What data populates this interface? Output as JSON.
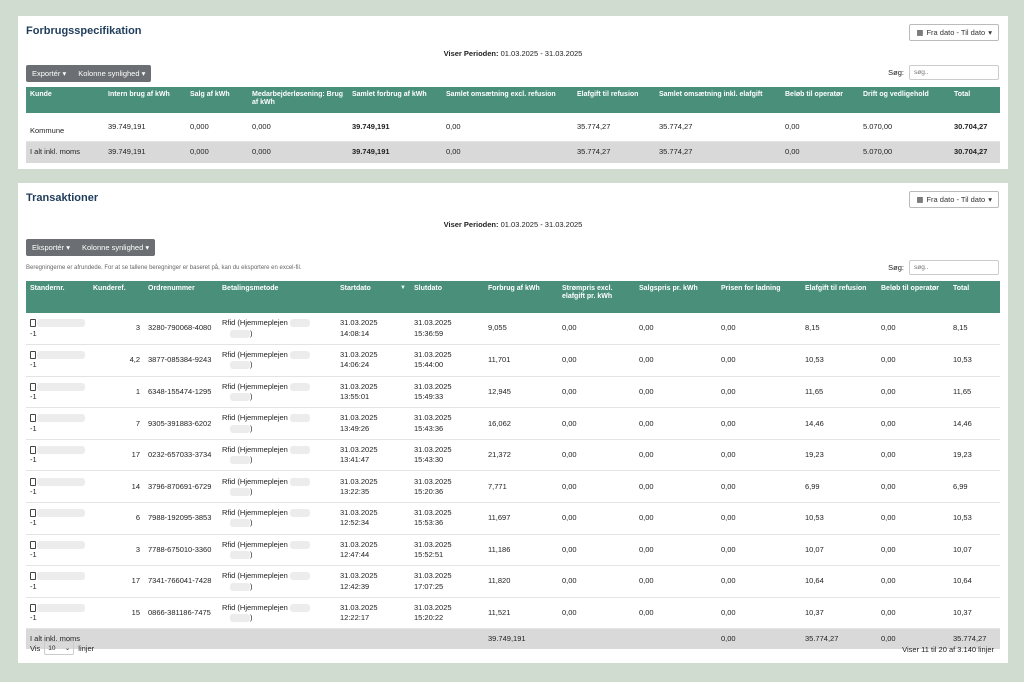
{
  "spec": {
    "title": "Forbrugsspecifikation",
    "date_button": "Fra dato - Til dato",
    "period_label": "Viser Perioden:",
    "period_value": "01.03.2025 - 31.03.2025",
    "export_label": "Exportér",
    "columns_label": "Kolonne synlighed",
    "search_label": "Søg:",
    "search_placeholder": "søg..",
    "headers": [
      "Kunde",
      "Intern brug af kWh",
      "Salg af kWh",
      "Medarbejderløsening: Brug af kWh",
      "Samlet forbrug af kWh",
      "Samlet omsætning excl. refusion",
      "Elafgift til refusion",
      "Samlet omsætning inkl. elafgift",
      "Beløb til operatør",
      "Drift og vedligehold",
      "Total"
    ],
    "rows": [
      [
        "Kommune",
        "39.749,191",
        "0,000",
        "0,000",
        "39.749,191",
        "0,00",
        "35.774,27",
        "35.774,27",
        "0,00",
        "5.070,00",
        "30.704,27"
      ]
    ],
    "total_row": [
      "I alt inkl. moms",
      "39.749,191",
      "0,000",
      "0,000",
      "39.749,191",
      "0,00",
      "35.774,27",
      "35.774,27",
      "0,00",
      "5.070,00",
      "30.704,27"
    ]
  },
  "trans": {
    "title": "Transaktioner",
    "date_button": "Fra dato - Til dato",
    "period_label": "Viser Perioden:",
    "period_value": "01.03.2025 - 31.03.2025",
    "export_label": "Eksportér",
    "columns_label": "Kolonne synlighed",
    "note": "Beregningerne er afrundede. For at se tallene beregninger er baseret på, kan du eksportere en excel-fil.",
    "search_label": "Søg:",
    "search_placeholder": "søg..",
    "headers": [
      "Standernr.",
      "Kunderef.",
      "Ordrenummer",
      "Betalingsmetode",
      "Startdato",
      "Slutdato",
      "Forbrug af kWh",
      "Strømpris excl. elafgift pr. kWh",
      "Salgspris pr. kWh",
      "Prisen for ladning",
      "Elafgift til refusion",
      "Beløb til operatør",
      "Total"
    ],
    "rows": [
      {
        "stander": "-1",
        "ref": "3",
        "order": "3280-790068-4080",
        "pay": "Rfid (Hjemmeplejen",
        "start": "31.03.2025 14:08:14",
        "end": "31.03.2025 15:36:59",
        "kwh": "9,055",
        "pris": "0,00",
        "salg": "0,00",
        "lad": "0,00",
        "elaf": "8,15",
        "oper": "0,00",
        "total": "8,15"
      },
      {
        "stander": "-1",
        "ref": "4,2",
        "order": "3877-085384-9243",
        "pay": "Rfid (Hjemmeplejen",
        "start": "31.03.2025 14:06:24",
        "end": "31.03.2025 15:44:00",
        "kwh": "11,701",
        "pris": "0,00",
        "salg": "0,00",
        "lad": "0,00",
        "elaf": "10,53",
        "oper": "0,00",
        "total": "10,53"
      },
      {
        "stander": "-1",
        "ref": "1",
        "order": "6348-155474-1295",
        "pay": "Rfid (Hjemmeplejen",
        "start": "31.03.2025 13:55:01",
        "end": "31.03.2025 15:49:33",
        "kwh": "12,945",
        "pris": "0,00",
        "salg": "0,00",
        "lad": "0,00",
        "elaf": "11,65",
        "oper": "0,00",
        "total": "11,65"
      },
      {
        "stander": "-1",
        "ref": "7",
        "order": "9305-391883-6202",
        "pay": "Rfid (Hjemmeplejen",
        "start": "31.03.2025 13:49:26",
        "end": "31.03.2025 15:43:36",
        "kwh": "16,062",
        "pris": "0,00",
        "salg": "0,00",
        "lad": "0,00",
        "elaf": "14,46",
        "oper": "0,00",
        "total": "14,46"
      },
      {
        "stander": "-1",
        "ref": "17",
        "order": "0232-657033-3734",
        "pay": "Rfid (Hjemmeplejen",
        "start": "31.03.2025 13:41:47",
        "end": "31.03.2025 15:43:30",
        "kwh": "21,372",
        "pris": "0,00",
        "salg": "0,00",
        "lad": "0,00",
        "elaf": "19,23",
        "oper": "0,00",
        "total": "19,23"
      },
      {
        "stander": "-1",
        "ref": "14",
        "order": "3796-870691-6729",
        "pay": "Rfid (Hjemmeplejen",
        "start": "31.03.2025 13:22:35",
        "end": "31.03.2025 15:20:36",
        "kwh": "7,771",
        "pris": "0,00",
        "salg": "0,00",
        "lad": "0,00",
        "elaf": "6,99",
        "oper": "0,00",
        "total": "6,99"
      },
      {
        "stander": "-1",
        "ref": "6",
        "order": "7988-192095-3853",
        "pay": "Rfid (Hjemmeplejen",
        "start": "31.03.2025 12:52:34",
        "end": "31.03.2025 15:53:36",
        "kwh": "11,697",
        "pris": "0,00",
        "salg": "0,00",
        "lad": "0,00",
        "elaf": "10,53",
        "oper": "0,00",
        "total": "10,53"
      },
      {
        "stander": "-1",
        "ref": "3",
        "order": "7788-675010-3360",
        "pay": "Rfid (Hjemmeplejen",
        "start": "31.03.2025 12:47:44",
        "end": "31.03.2025 15:52:51",
        "kwh": "11,186",
        "pris": "0,00",
        "salg": "0,00",
        "lad": "0,00",
        "elaf": "10,07",
        "oper": "0,00",
        "total": "10,07"
      },
      {
        "stander": "-1",
        "ref": "17",
        "order": "7341-766041-7428",
        "pay": "Rfid (Hjemmeplejen",
        "start": "31.03.2025 12:42:39",
        "end": "31.03.2025 17:07:25",
        "kwh": "11,820",
        "pris": "0,00",
        "salg": "0,00",
        "lad": "0,00",
        "elaf": "10,64",
        "oper": "0,00",
        "total": "10,64"
      },
      {
        "stander": "-1",
        "ref": "15",
        "order": "0866-381186-7475",
        "pay": "Rfid (Hjemmeplejen",
        "start": "31.03.2025 12:22:17",
        "end": "31.03.2025 15:20:22",
        "kwh": "11,521",
        "pris": "0,00",
        "salg": "0,00",
        "lad": "0,00",
        "elaf": "10,37",
        "oper": "0,00",
        "total": "10,37"
      }
    ],
    "total_row": {
      "label": "I alt inkl. moms",
      "kwh": "39.749,191",
      "lad": "0,00",
      "elaf": "35.774,27",
      "oper": "0,00",
      "total": "35.774,27"
    },
    "show_label": "Vis",
    "show_value": "10",
    "lines_label": "linjer",
    "pagination_text": "Viser 11 til 20 af 3.140 linjer"
  }
}
